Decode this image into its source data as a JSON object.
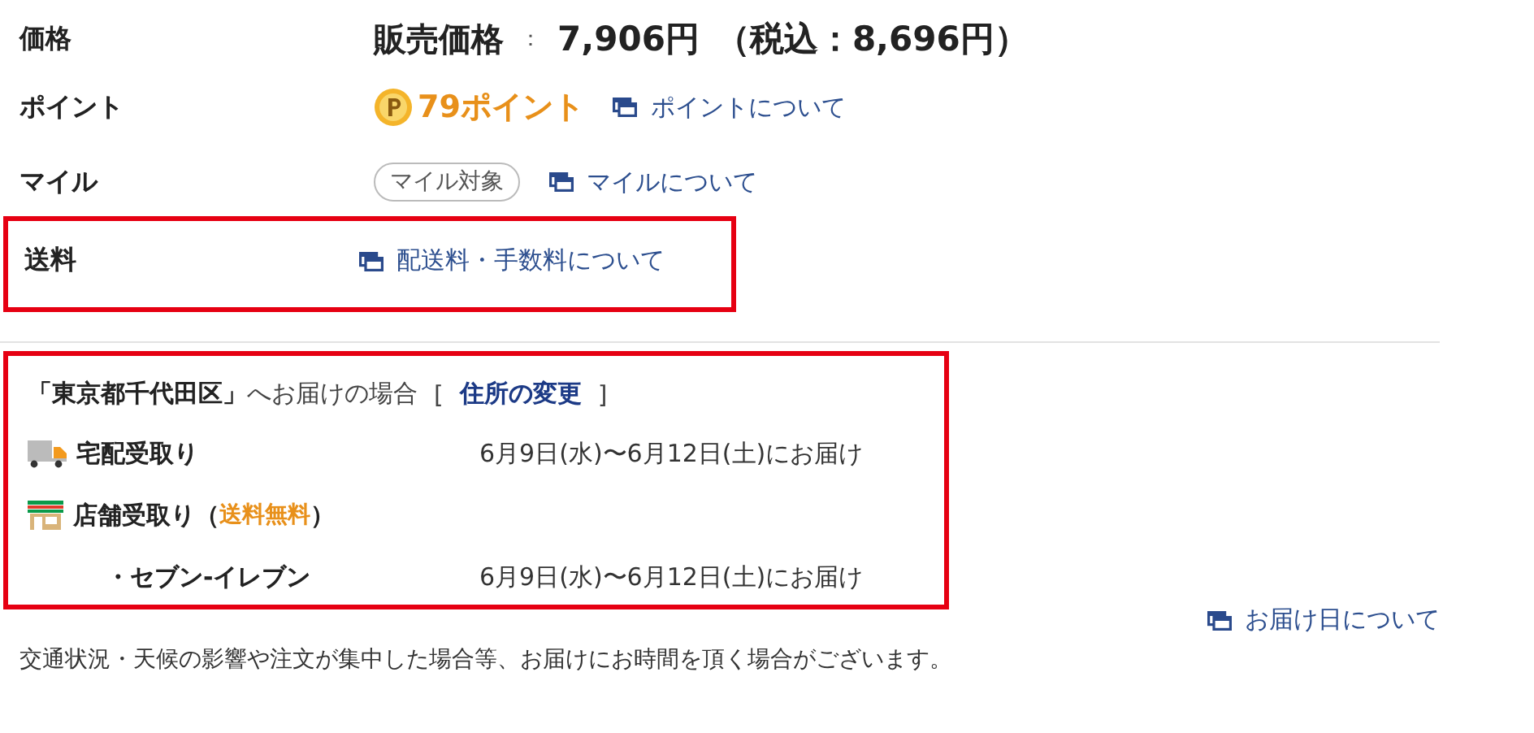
{
  "price_row": {
    "label": "価格",
    "price_label": "販売価格",
    "separator": "：",
    "price": "7,906円",
    "tax_included": "（税込：8,696円）"
  },
  "point_row": {
    "label": "ポイント",
    "points": "79ポイント",
    "link": "ポイントについて"
  },
  "mile_row": {
    "label": "マイル",
    "badge": "マイル対象",
    "link": "マイルについて"
  },
  "shipping_row": {
    "label": "送料",
    "link": "配送料・手数料について"
  },
  "delivery": {
    "destination": "**「東京都千代田区」**へお届けの場合",
    "bracket_open": "[",
    "change_link": "住所の変更",
    "bracket_close": "]",
    "options": [
      {
        "kind": "home",
        "name": "宅配受取り",
        "date": "6月9日(水)〜6月12日(土)にお届け"
      },
      {
        "kind": "store",
        "name": "店舗受取り",
        "open": "（",
        "free": "送料無料",
        "close": "）"
      },
      {
        "kind": "store_entry",
        "name": "・セブン-イレブン",
        "date": "6月9日(水)〜6月12日(土)にお届け"
      }
    ]
  },
  "footer": {
    "link": "お届け日について",
    "note": "交通状況・天候の影響や注文が集中した場合等、お届けにお時間を頂く場合がございます。"
  }
}
